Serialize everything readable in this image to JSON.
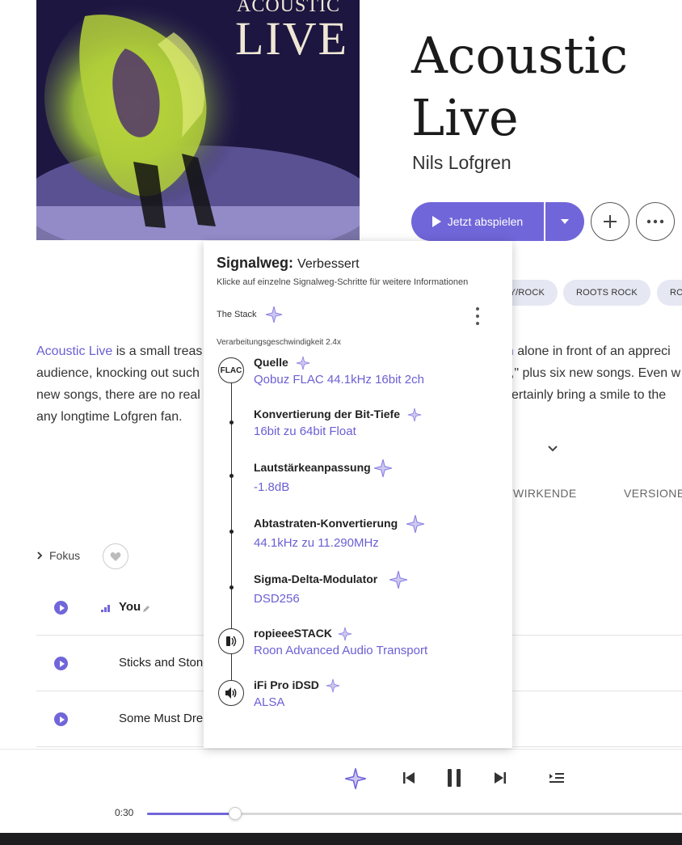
{
  "album": {
    "cover_line1": "ACOUSTIC",
    "cover_line2": "LIVE",
    "title_line1": "Acoustic",
    "title_line2": "Live",
    "artist": "Nils Lofgren"
  },
  "actions": {
    "play_now": "Jetzt abspielen"
  },
  "genres": [
    "Y/ROCK",
    "ROOTS ROCK",
    "RO"
  ],
  "review": {
    "line1_link": "Acoustic Live",
    "line1_text": " is a small treas",
    "line1_link2": "en",
    "line1_tail": " alone in front of an appreci",
    "line2_left": "audience, knocking out such",
    "line2_right": "o,\" plus six new songs. Even w",
    "line3_left": "new songs, there are no real",
    "line3_right": "certainly bring a smile to the",
    "line4": "any longtime Lofgren fan."
  },
  "tabs": [
    "TWIRKENDE",
    "VERSIONE"
  ],
  "tracks_header": {
    "fokus": "Fokus"
  },
  "tracks": [
    {
      "name": "You"
    },
    {
      "name": "Sticks and Stone"
    },
    {
      "name": "Some Must Drea"
    }
  ],
  "signal_path": {
    "title_bold": "Signalweg:",
    "title_quality": "Verbessert",
    "subtitle": "Klicke auf einzelne Signalweg-Schritte für weitere Informationen",
    "stack_name": "The Stack",
    "speed": "Verarbeitungsgeschwindigkeit 2.4x",
    "source_badge": "FLAC",
    "steps": [
      {
        "label": "Quelle",
        "value": "Qobuz FLAC 44.1kHz 16bit 2ch"
      },
      {
        "label": "Konvertierung der Bit-Tiefe",
        "value": "16bit zu 64bit Float"
      },
      {
        "label": "Lautstärkeanpassung",
        "value": "-1.8dB"
      },
      {
        "label": "Abtastraten-Konvertierung",
        "value": "44.1kHz zu 11.290MHz"
      },
      {
        "label": "Sigma-Delta-Modulator",
        "value": "DSD256"
      },
      {
        "label": "ropieeeSTACK",
        "value": "Roon Advanced Audio Transport"
      },
      {
        "label": "iFi Pro iDSD",
        "value": "ALSA"
      }
    ]
  },
  "player": {
    "elapsed": "0:30",
    "progress_fraction": 0.165
  },
  "colors": {
    "accent": "#7166d9",
    "link": "#6a5fd3"
  }
}
